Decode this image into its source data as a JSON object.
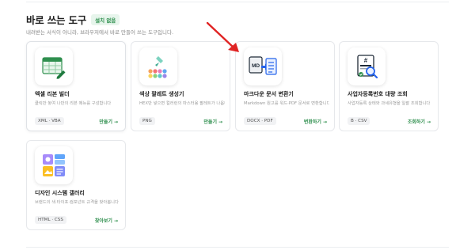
{
  "section": {
    "title": "바로 쓰는 도구",
    "badge": "설치 없음",
    "description": "내려받는 서식이 아니라, 브라우저에서 바로 만들어 쓰는 도구입니다."
  },
  "cards": [
    {
      "title": "엑셀 리본 빌더",
      "description": "클릭만 놓여 나만의 리본 메뉴를 구성합니다",
      "tag": "XML · VBA",
      "action": "만들기",
      "arrow": "→",
      "icon": "spreadsheet-edit-icon"
    },
    {
      "title": "색상 팔레트 생성기",
      "description": "HEX만 넣으면 컬러런의 마스터용 팔레트가 나옵니다",
      "tag": "PNG",
      "action": "만들기",
      "arrow": "→",
      "icon": "color-palette-icon"
    },
    {
      "title": "마크다운 문서 변환기",
      "description": "Markdown 원고를 워드·PDF 문서로 변환합니다",
      "tag": "DOCX · PDF",
      "action": "변환하기",
      "arrow": "→",
      "icon": "markdown-convert-icon"
    },
    {
      "title": "사업자등록번호 대량 조회",
      "description": "사업자등록 상태와 과세유형을 일괄 조회합니다",
      "tag": "B · CSV",
      "action": "조회하기",
      "arrow": "→",
      "icon": "document-search-icon",
      "icon_label": "#"
    },
    {
      "title": "디자인 시스템 갤러리",
      "description": "브랜드의 색·타이포·컴포넌트 규격을 찾아봅니다",
      "tag": "HTML · CSS",
      "action": "찾아보기",
      "arrow": "→",
      "icon": "design-gallery-icon"
    }
  ],
  "markdown_icon_label": "MD",
  "colors": {
    "accent": "#2f8f4e",
    "annotation_arrow": "#e02424"
  }
}
